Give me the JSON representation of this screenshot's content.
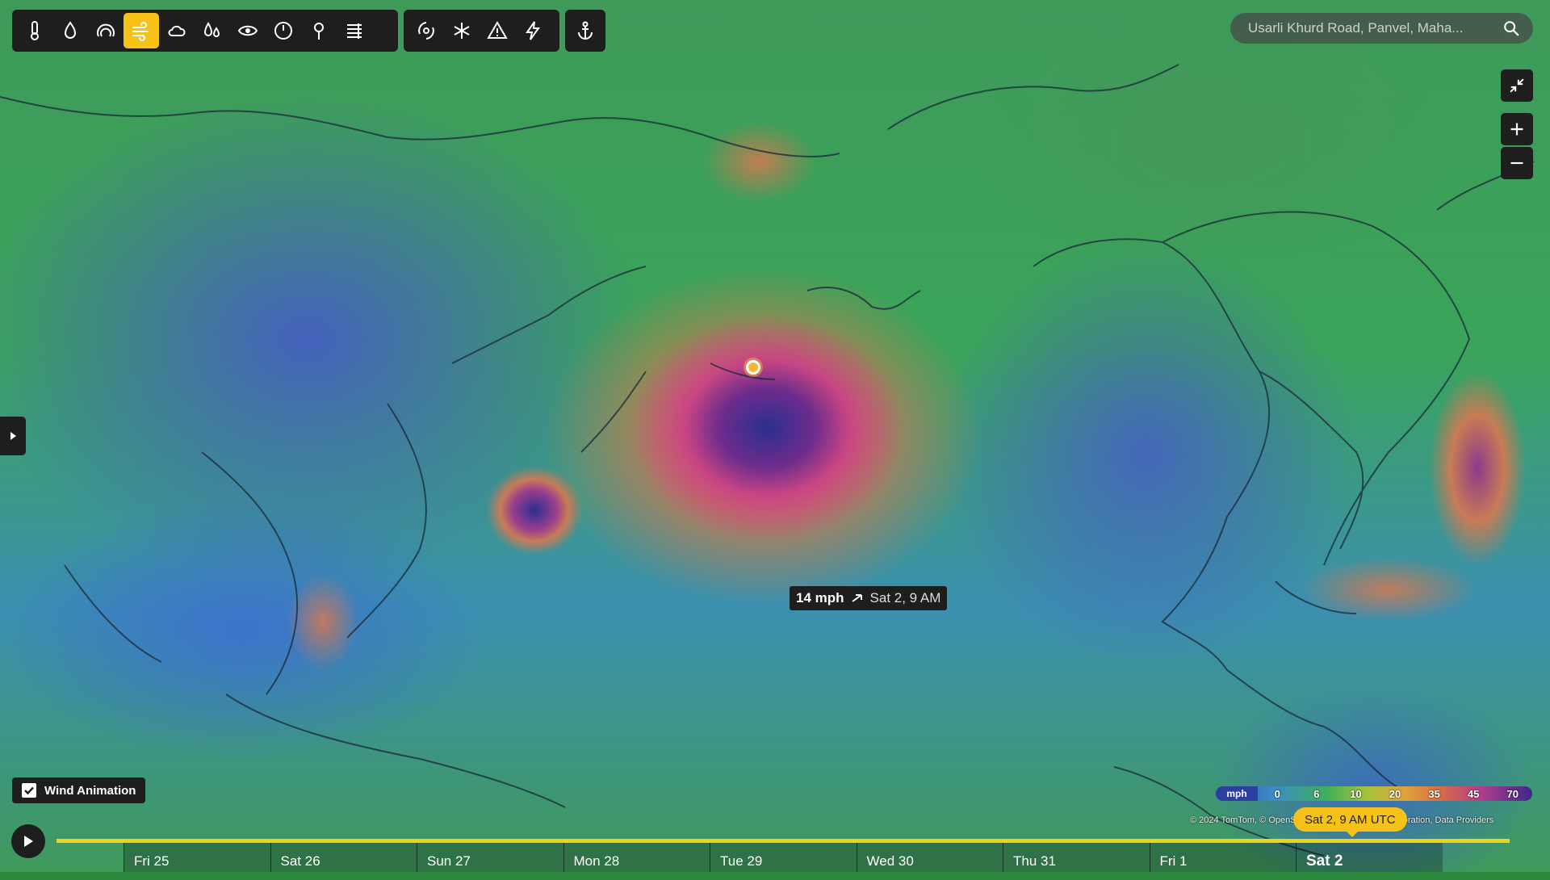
{
  "toolbar": {
    "groups": [
      [
        "thermometer-icon",
        "droplet-icon",
        "pressure-gauge-icon",
        "wind-icon",
        "cloud-icon",
        "humidity-drops-icon",
        "visibility-eye-icon",
        "gauge-icon",
        "balloon-pin-icon",
        "waves-icon"
      ],
      [
        "hurricane-icon",
        "snowflake-wind-icon",
        "warning-triangle-icon",
        "lightning-icon"
      ],
      [
        "anchor-icon"
      ]
    ],
    "active": "wind-icon",
    "accent_color": "#f6c21a"
  },
  "search": {
    "placeholder": "Usarli Khurd Road, Panvel, Maha..."
  },
  "tooltip": {
    "value": "14 mph",
    "time": "Sat 2, 9 AM"
  },
  "wind_animation": {
    "label": "Wind Animation",
    "checked": true
  },
  "legend": {
    "unit": "mph",
    "ticks": [
      "0",
      "6",
      "10",
      "20",
      "35",
      "45",
      "70"
    ]
  },
  "attribution": "© 2024 TomTom, © OpenStreetMap, © Microsoft Corporation, Data Providers",
  "time_badge": "Sat 2, 9 AM UTC",
  "timeline": {
    "days": [
      "Fri 25",
      "Sat 26",
      "Sun 27",
      "Mon 28",
      "Tue 29",
      "Wed 30",
      "Thu 31",
      "Fri 1",
      "Sat 2"
    ],
    "current": "Sat 2"
  }
}
